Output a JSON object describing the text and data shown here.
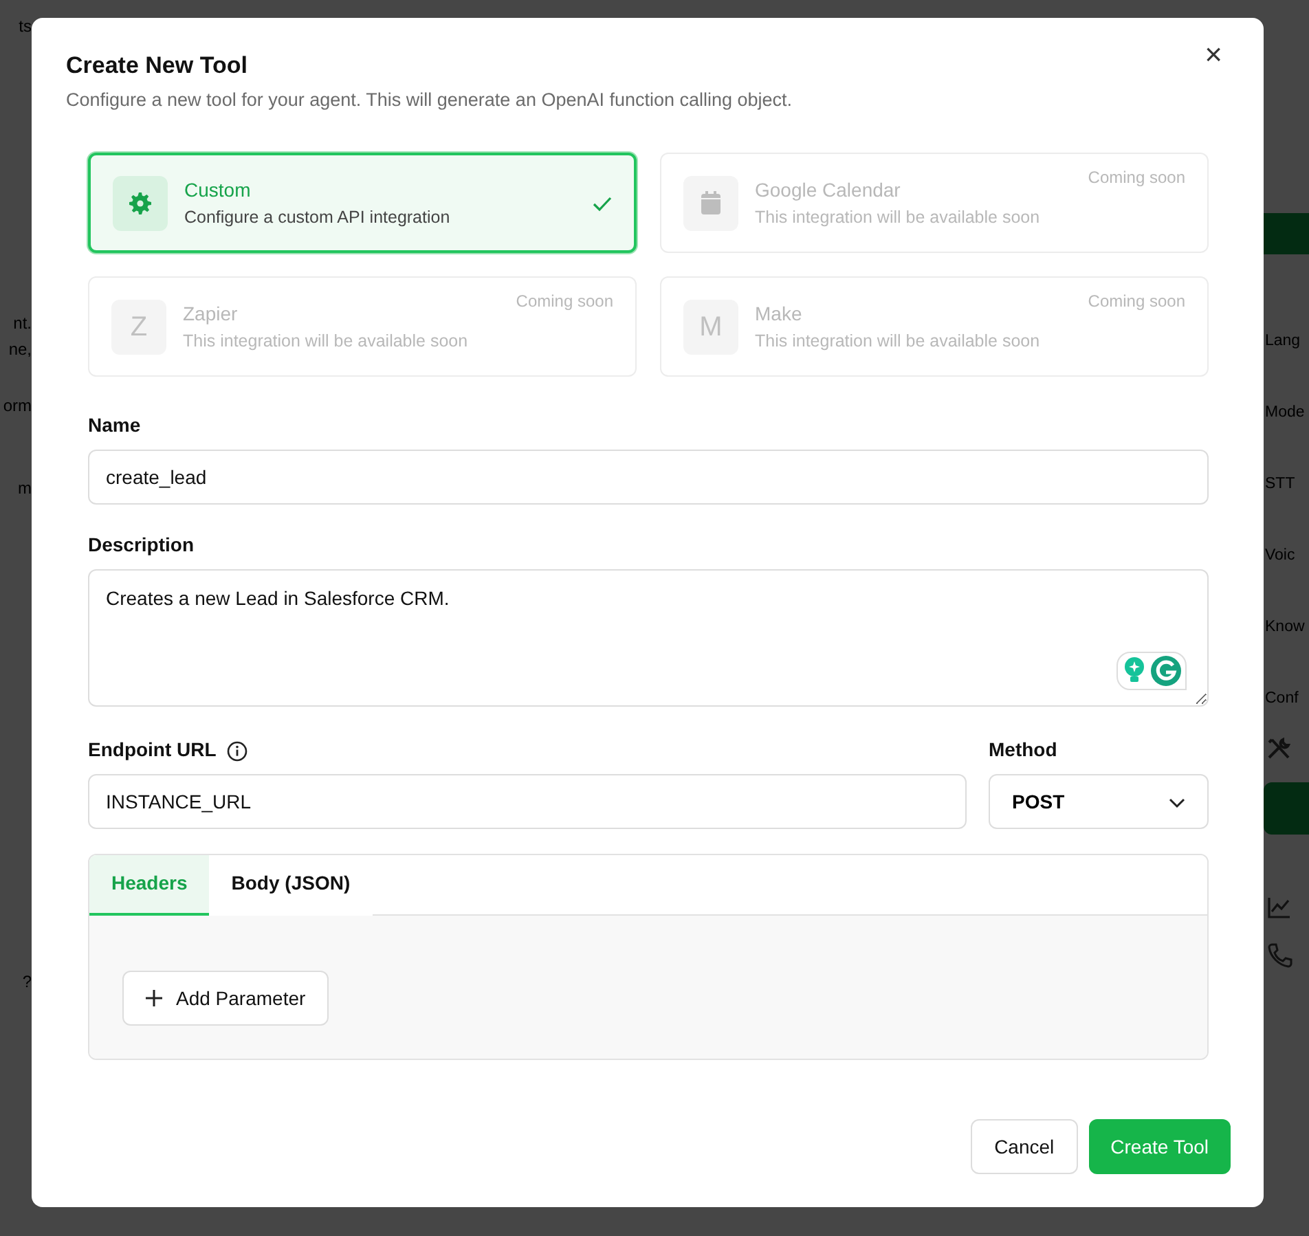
{
  "backdrop": {
    "left": [
      {
        "text": "ts"
      },
      {
        "text": "nt."
      },
      {
        "text": "ne,"
      },
      {
        "text": "orm"
      },
      {
        "text": "m"
      },
      {
        "text": "?"
      }
    ],
    "right": [
      {
        "text": "Lang"
      },
      {
        "text": "Mode"
      },
      {
        "text": "STT"
      },
      {
        "text": "Voic"
      },
      {
        "text": "Know"
      },
      {
        "text": "Conf"
      }
    ]
  },
  "dialog": {
    "title": "Create New Tool",
    "subtitle": "Configure a new tool for your agent. This will generate an OpenAI function calling object.",
    "close": "×",
    "integrations": [
      {
        "kind": "gear",
        "name": "Custom",
        "description": "Configure a custom API integration",
        "selected": true,
        "disabled": false
      },
      {
        "kind": "calendar",
        "name": "Google Calendar",
        "description": "This integration will be available soon",
        "selected": false,
        "disabled": true,
        "badge": "Coming soon"
      },
      {
        "kind": "letter",
        "letter": "Z",
        "name": "Zapier",
        "description": "This integration will be available soon",
        "selected": false,
        "disabled": true,
        "badge": "Coming soon"
      },
      {
        "kind": "letter",
        "letter": "M",
        "name": "Make",
        "description": "This integration will be available soon",
        "selected": false,
        "disabled": true,
        "badge": "Coming soon"
      }
    ],
    "name": {
      "label": "Name",
      "value": "create_lead"
    },
    "description": {
      "label": "Description",
      "value": "Creates a new Lead in Salesforce CRM."
    },
    "endpoint": {
      "label": "Endpoint URL",
      "value": "INSTANCE_URL"
    },
    "method": {
      "label": "Method",
      "value": "POST"
    },
    "tabs": [
      {
        "label": "Headers",
        "selected": true
      },
      {
        "label": "Body (JSON)",
        "selected": false
      }
    ],
    "add_parameter": "Add Parameter",
    "buttons": [
      {
        "label": "Cancel",
        "kind": "secondary"
      },
      {
        "label": "Create Tool",
        "kind": "primary"
      }
    ]
  }
}
